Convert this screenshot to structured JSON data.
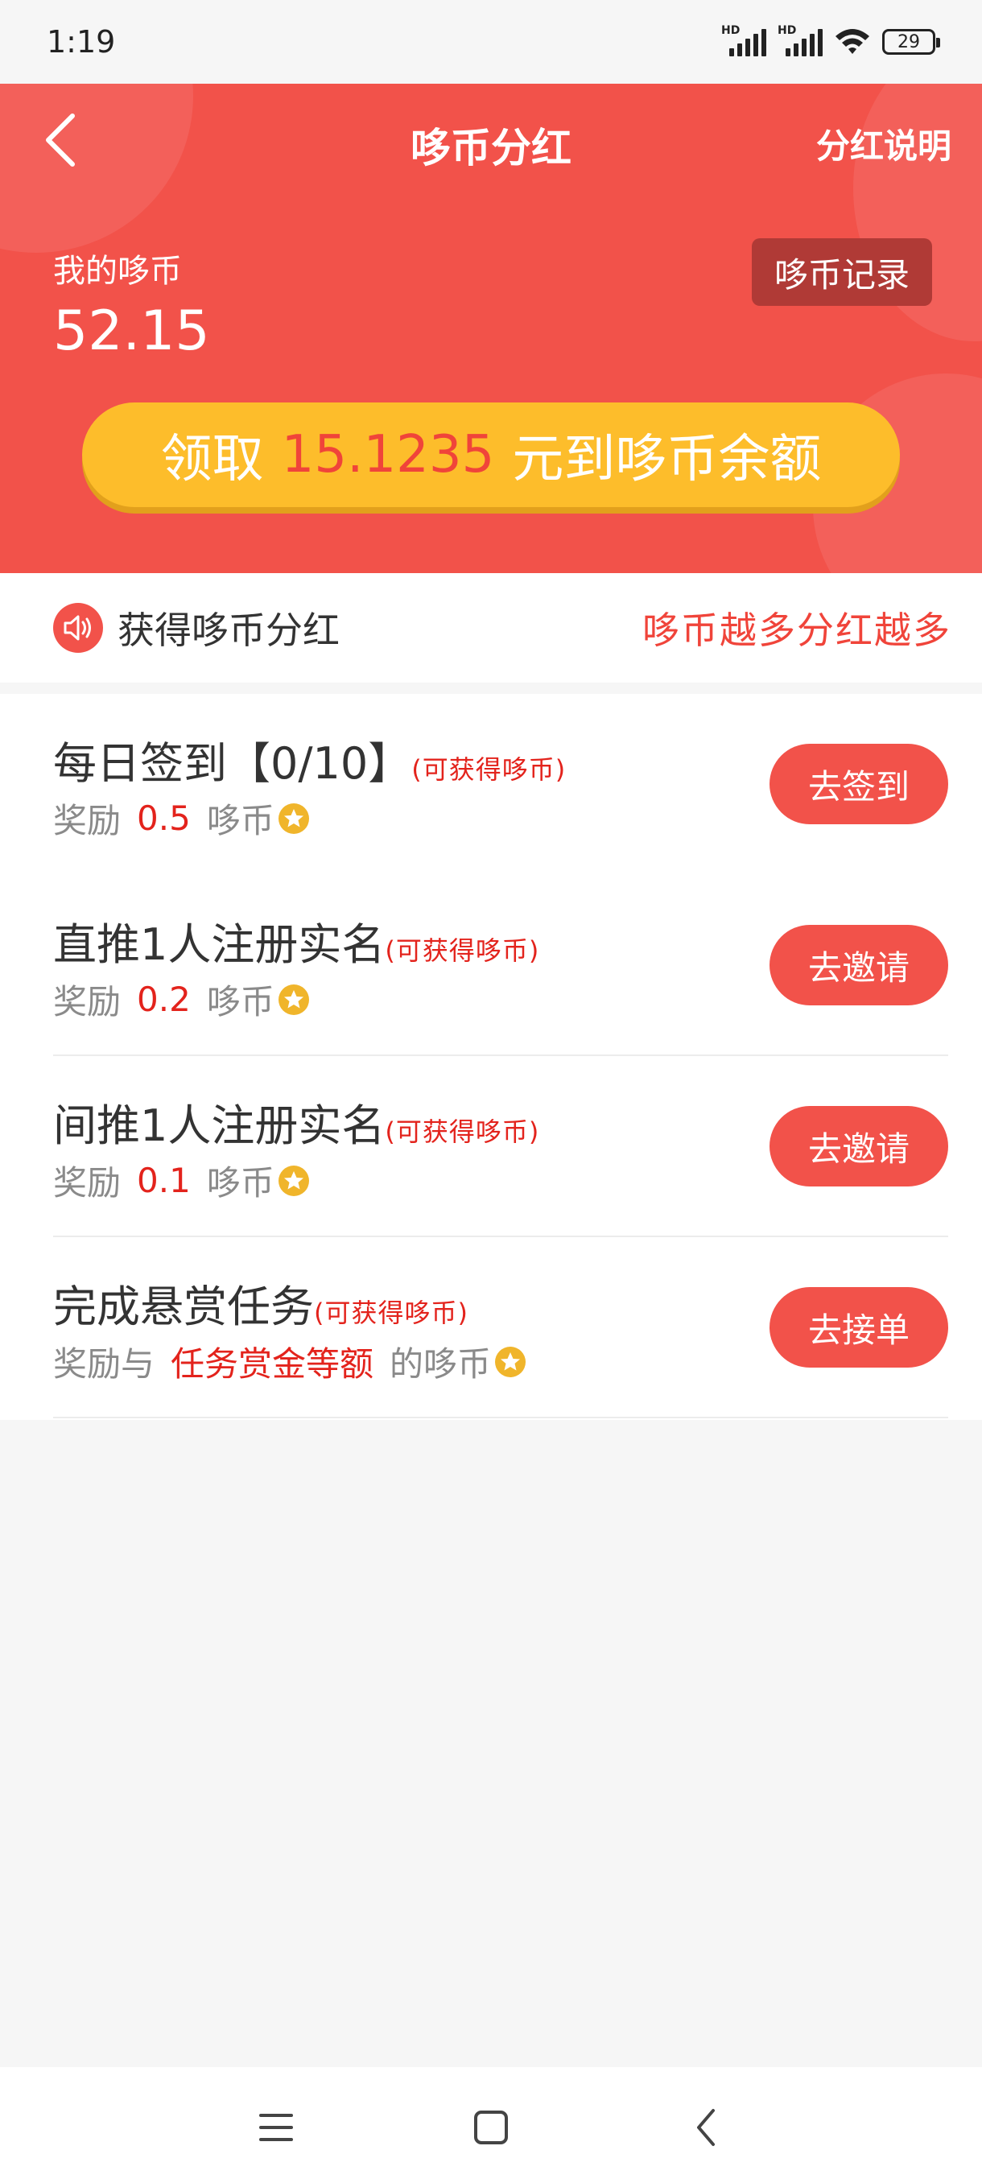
{
  "status_bar": {
    "time": "1:19",
    "signal_label_1": "HD",
    "signal_label_2": "HD",
    "battery": "29"
  },
  "header": {
    "title": "哆币分红",
    "right_link": "分红说明",
    "coin_label": "我的哆币",
    "coin_value": "52.15",
    "record_button": "哆币记录",
    "claim": {
      "prefix": "领取",
      "amount": "15.1235",
      "suffix": "元到哆币余额"
    }
  },
  "notice": {
    "title": "获得哆币分红",
    "slogan": "哆币越多分红越多"
  },
  "tasks": [
    {
      "title": "每日签到【0/10】",
      "hint": "(可获得哆币)",
      "reward_prefix": "奖励",
      "reward_value": "0.5",
      "reward_suffix": "哆币",
      "button": "去签到"
    },
    {
      "title": "直推1人注册实名",
      "hint": "(可获得哆币)",
      "reward_prefix": "奖励",
      "reward_value": "0.2",
      "reward_suffix": "哆币",
      "button": "去邀请"
    },
    {
      "title": "间推1人注册实名",
      "hint": "(可获得哆币)",
      "reward_prefix": "奖励",
      "reward_value": "0.1",
      "reward_suffix": "哆币",
      "button": "去邀请"
    },
    {
      "title": "完成悬赏任务",
      "hint": "(可获得哆币)",
      "reward_prefix": "奖励与",
      "reward_value": "任务赏金等额",
      "reward_suffix": "的哆币",
      "button": "去接单"
    }
  ],
  "colors": {
    "primary_red": "#f2524a",
    "claim_yellow": "#fdbd2b",
    "highlight_red": "#e3231c",
    "coin_gold": "#f0b52b"
  },
  "icons": {
    "back": "chevron-left-icon",
    "notice": "speaker-icon",
    "coin": "star-coin-icon",
    "sys_menu": "menu-icon",
    "sys_home": "home-square-icon",
    "sys_back": "back-chevron-icon"
  }
}
